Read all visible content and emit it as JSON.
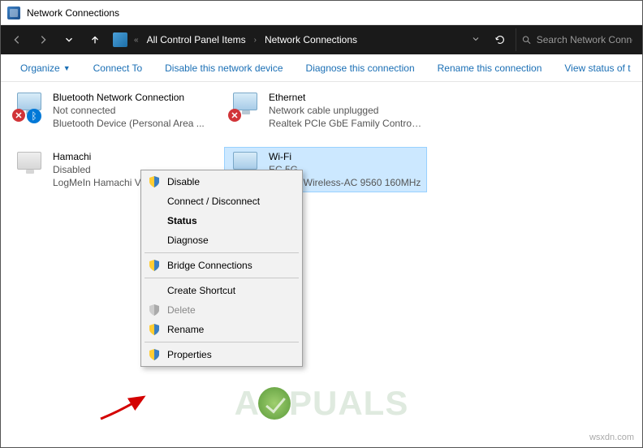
{
  "titlebar": {
    "title": "Network Connections"
  },
  "breadcrumb": {
    "prefix": "«",
    "item1": "All Control Panel Items",
    "item2": "Network Connections"
  },
  "search": {
    "placeholder": "Search Network Connec"
  },
  "toolbar": {
    "organize": "Organize",
    "connect": "Connect To",
    "disable": "Disable this network device",
    "diagnose": "Diagnose this connection",
    "rename": "Rename this connection",
    "viewstatus": "View status of t"
  },
  "connections": {
    "bluetooth": {
      "name": "Bluetooth Network Connection",
      "status": "Not connected",
      "device": "Bluetooth Device (Personal Area ..."
    },
    "ethernet": {
      "name": "Ethernet",
      "status": "Network cable unplugged",
      "device": "Realtek PCIe GbE Family Controller"
    },
    "hamachi": {
      "name": "Hamachi",
      "status": "Disabled",
      "device": "LogMeIn Hamachi Virtual Etherne..."
    },
    "wifi": {
      "name": "Wi-Fi",
      "status": "EC 5G",
      "device": "Intel(R) Wireless-AC 9560 160MHz"
    }
  },
  "contextmenu": {
    "disable": "Disable",
    "connect": "Connect / Disconnect",
    "status": "Status",
    "diagnose": "Diagnose",
    "bridge": "Bridge Connections",
    "shortcut": "Create Shortcut",
    "delete": "Delete",
    "rename": "Rename",
    "properties": "Properties"
  },
  "watermark": {
    "pre": "A",
    "post": "PUALS"
  },
  "footer": "wsxdn.com"
}
